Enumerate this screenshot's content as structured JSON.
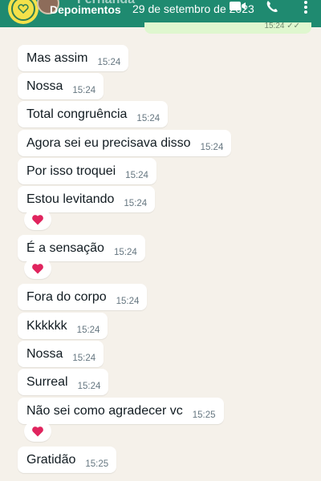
{
  "header": {
    "title": "Depoimentos",
    "contact_name": "Fernanda",
    "date": "29 de setembro de 2023",
    "icons": [
      "logo",
      "avatar",
      "video-icon",
      "phone-icon",
      "menu-icon"
    ]
  },
  "outgoing_stub": {
    "time": "15:24 ✓✓"
  },
  "messages": [
    {
      "text": "Mas assim",
      "time": "15:24"
    },
    {
      "text": "Nossa",
      "time": "15:24"
    },
    {
      "text": "Total congruência",
      "time": "15:24"
    },
    {
      "text": "Agora sei eu precisava disso",
      "time": "15:24"
    },
    {
      "text": "Por isso troquei",
      "time": "15:24"
    },
    {
      "text": "Estou levitando",
      "time": "15:24",
      "reaction": "❤️"
    },
    {
      "text": "É a sensação",
      "time": "15:24",
      "reaction": "❤️"
    },
    {
      "text": "Fora do corpo",
      "time": "15:24"
    },
    {
      "text": "Kkkkkk",
      "time": "15:24"
    },
    {
      "text": "Nossa",
      "time": "15:24"
    },
    {
      "text": "Surreal",
      "time": "15:24"
    },
    {
      "text": "Não sei como agradecer vc",
      "time": "15:25",
      "reaction": "❤️"
    },
    {
      "text": "Gratidão",
      "time": "15:25"
    }
  ],
  "colors": {
    "header": "#1f8a70",
    "background": "#f5f1ea",
    "bubble": "#ffffff",
    "heart": "#e0245e"
  }
}
